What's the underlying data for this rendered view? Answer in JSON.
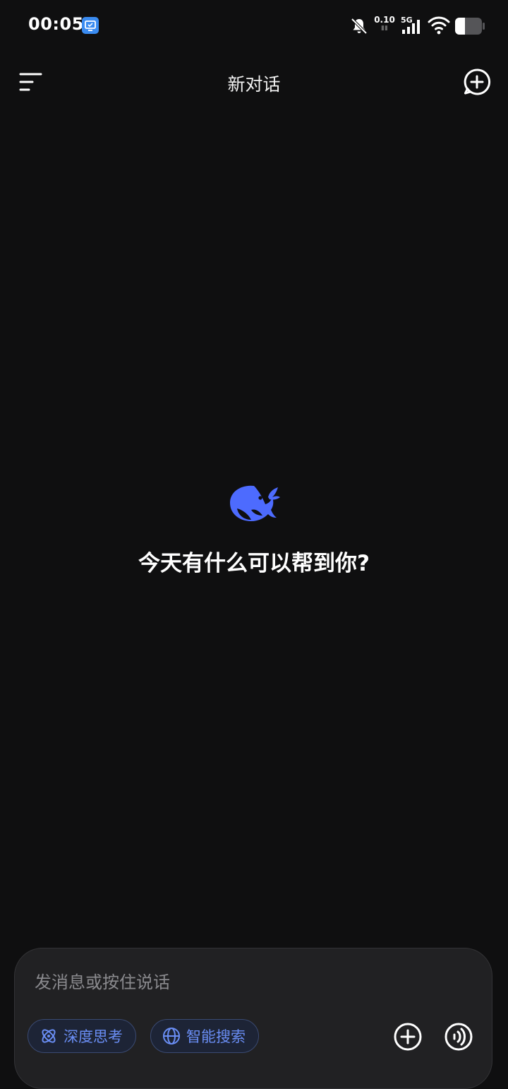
{
  "status_bar": {
    "time": "00:05",
    "net_speed": "0.10",
    "net_type": "5G",
    "app_icon": "screen-mirror-icon"
  },
  "header": {
    "title": "新对话",
    "menu_icon": "menu-icon",
    "new_chat_icon": "new-chat-icon"
  },
  "main": {
    "logo": "whale-logo-icon",
    "welcome": "今天有什么可以帮到你?"
  },
  "composer": {
    "placeholder": "发消息或按住说话",
    "chips": [
      {
        "label": "深度思考",
        "icon": "atom-icon"
      },
      {
        "label": "智能搜索",
        "icon": "globe-icon"
      }
    ],
    "attach_icon": "plus-circle-icon",
    "voice_icon": "voice-wave-icon"
  },
  "colors": {
    "background": "#0f0f10",
    "accent": "#4d6bfe",
    "chip_text": "#6a8ef5"
  }
}
